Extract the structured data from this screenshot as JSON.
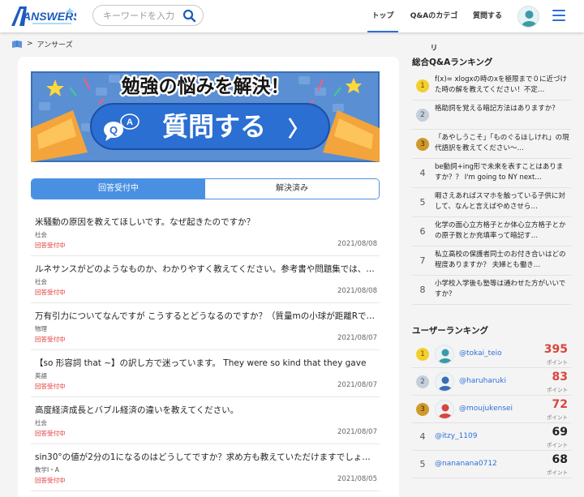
{
  "header": {
    "logo_text": "ANSWERS",
    "search": {
      "placeholder": "キーワードを入力"
    },
    "nav": [
      "トップ",
      "Q&Aのカテゴリ",
      "質問する"
    ],
    "accent": "#2f6fd6"
  },
  "breadcrumb": {
    "current": "アンサーズ",
    "separator": ">"
  },
  "banner": {
    "headline": "勉強の悩みを解決！",
    "cta": "質問する",
    "badge_letters": [
      "Q",
      "A"
    ],
    "arrow": "〉"
  },
  "tabs": [
    {
      "label": "回答受付中"
    },
    {
      "label": "解決済み"
    }
  ],
  "questions": [
    {
      "title": "米騒動の原因を教えてほしいです。なぜ起きたのですか？",
      "category": "社会",
      "status": "回答受付中",
      "date": "2021/08/08"
    },
    {
      "title": "ルネサンスがどのようなものか、わかりやすく教えてください。参考書や問題集では、…",
      "category": "社会",
      "status": "回答受付中",
      "date": "2021/08/08"
    },
    {
      "title": "万有引力についてなんですが こうするとどうなるのですか？（質量mの小球が距離Rで…",
      "category": "物理",
      "status": "回答受付中",
      "date": "2021/08/07"
    },
    {
      "title": "【so 形容詞 that ~】の訳し方で迷っています。 They were so kind that they gave",
      "category": "英語",
      "status": "回答受付中",
      "date": "2021/08/07"
    },
    {
      "title": "高度経済成長とバブル経済の違いを教えてください。",
      "category": "社会",
      "status": "回答受付中",
      "date": "2021/08/07"
    },
    {
      "title": "sin30°の値が2分の1になるのはどうしてですか？求め方も教えていただけますでしょ…",
      "category": "数学Ⅰ・A",
      "status": "回答受付中",
      "date": "2021/08/05"
    }
  ],
  "qa_ranking": {
    "heading": "総合Q&Aランキング",
    "items": [
      {
        "rank": "1",
        "text": "f(x)= xlogxの時のxを極限まで０に近づけた時の解を教えてください！不定…"
      },
      {
        "rank": "2",
        "text": "格助詞を覚える暗記方法はありますか？"
      },
      {
        "rank": "3",
        "text": "「あやしうこそ」「ものぐるほしけれ」の現代語訳を教えてください〜…"
      },
      {
        "rank": "4",
        "text": "be動詞+ing形で未来を表すことはありますか？？ I'm going to NY next…"
      },
      {
        "rank": "5",
        "text": "暇さえあればスマホを触っている子供に対して、なんと言えばやめさせら…"
      },
      {
        "rank": "6",
        "text": "化学の面心立方格子とか体心立方格子とかの原子数とか充填率って暗記す…"
      },
      {
        "rank": "7",
        "text": "私立高校の保護者同士のお付き合いはどの程度ありますか？ 夫婦とも働き…"
      },
      {
        "rank": "8",
        "text": "小学校入学後も塾等は通わせた方がいいですか？"
      }
    ]
  },
  "user_ranking": {
    "heading": "ユーザーランキング",
    "points_label": "ポイント",
    "users": [
      {
        "rank": "1",
        "name": "@tokai_teio",
        "points": "395",
        "color": "#d9453c"
      },
      {
        "rank": "2",
        "name": "@haruharuki",
        "points": "83",
        "color": "#d9453c"
      },
      {
        "rank": "3",
        "name": "@moujukensei",
        "points": "72",
        "color": "#d9453c"
      },
      {
        "rank": "4",
        "name": "@itzy_1109",
        "points": "69",
        "color": "#222222"
      },
      {
        "rank": "5",
        "name": "@nananana0712",
        "points": "68",
        "color": "#222222"
      }
    ]
  }
}
